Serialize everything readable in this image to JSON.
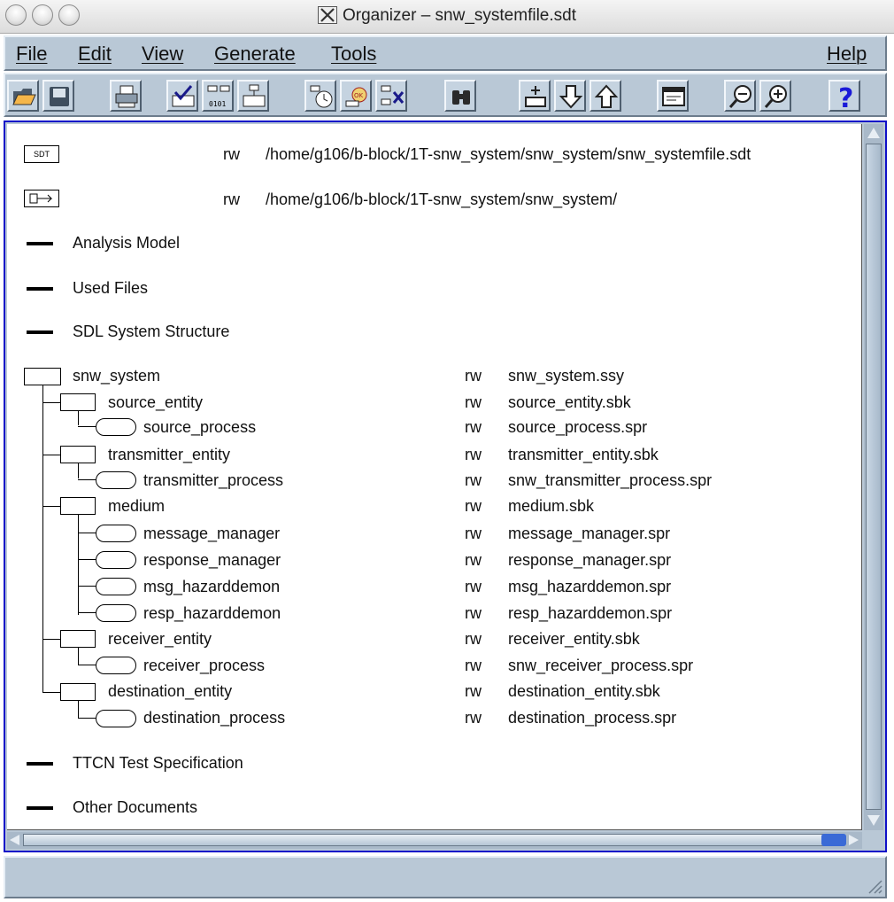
{
  "window": {
    "title": "Organizer – snw_systemfile.sdt"
  },
  "menu": {
    "items": [
      {
        "id": "file",
        "label": "File"
      },
      {
        "id": "edit",
        "label": "Edit"
      },
      {
        "id": "view",
        "label": "View"
      },
      {
        "id": "generate",
        "label": "Generate"
      },
      {
        "id": "tools",
        "label": "Tools"
      },
      {
        "id": "help",
        "label": "Help"
      }
    ]
  },
  "toolbar": {
    "buttons": [
      {
        "id": "open",
        "icon": "open-folder-icon"
      },
      {
        "id": "save",
        "icon": "save-icon"
      },
      {
        "id": "print",
        "icon": "print-icon"
      },
      {
        "id": "check",
        "icon": "check-icon"
      },
      {
        "id": "generate",
        "icon": "generate-icon"
      },
      {
        "id": "editor",
        "icon": "edit-diagram-icon"
      },
      {
        "id": "simulate",
        "icon": "simulate-icon"
      },
      {
        "id": "validate",
        "icon": "validate-icon"
      },
      {
        "id": "remove",
        "icon": "remove-icon"
      },
      {
        "id": "find",
        "icon": "binoculars-icon"
      },
      {
        "id": "add",
        "icon": "add-item-icon"
      },
      {
        "id": "move-down",
        "icon": "arrow-down-icon"
      },
      {
        "id": "move-up",
        "icon": "arrow-up-icon"
      },
      {
        "id": "window",
        "icon": "window-icon"
      },
      {
        "id": "zoom-out",
        "icon": "zoom-out-icon"
      },
      {
        "id": "zoom-in",
        "icon": "zoom-in-icon"
      },
      {
        "id": "help",
        "icon": "help-icon",
        "glyph": "?"
      }
    ]
  },
  "header_rows": [
    {
      "icon_text": "SDT",
      "perm": "rw",
      "path": "/home/g106/b-block/1T-snw_system/snw_system/snw_systemfile.sdt"
    },
    {
      "icon_text": "",
      "perm": "rw",
      "path": "/home/g106/b-block/1T-snw_system/snw_system/"
    }
  ],
  "chapters": {
    "analysis": "Analysis Model",
    "used_files": "Used Files",
    "sdl_structure": "SDL System Structure",
    "ttcn": "TTCN Test Specification",
    "other": "Other Documents"
  },
  "tree": [
    {
      "name": "snw_system",
      "perm": "rw",
      "file": "snw_system.ssy"
    },
    {
      "name": "source_entity",
      "perm": "rw",
      "file": "source_entity.sbk"
    },
    {
      "name": "source_process",
      "perm": "rw",
      "file": "source_process.spr"
    },
    {
      "name": "transmitter_entity",
      "perm": "rw",
      "file": "transmitter_entity.sbk"
    },
    {
      "name": "transmitter_process",
      "perm": "rw",
      "file": "snw_transmitter_process.spr"
    },
    {
      "name": "medium",
      "perm": "rw",
      "file": "medium.sbk"
    },
    {
      "name": "message_manager",
      "perm": "rw",
      "file": "message_manager.spr"
    },
    {
      "name": "response_manager",
      "perm": "rw",
      "file": "response_manager.spr"
    },
    {
      "name": "msg_hazarddemon",
      "perm": "rw",
      "file": "msg_hazarddemon.spr"
    },
    {
      "name": "resp_hazarddemon",
      "perm": "rw",
      "file": "resp_hazarddemon.spr"
    },
    {
      "name": "receiver_entity",
      "perm": "rw",
      "file": "receiver_entity.sbk"
    },
    {
      "name": "receiver_process",
      "perm": "rw",
      "file": "snw_receiver_process.spr"
    },
    {
      "name": "destination_entity",
      "perm": "rw",
      "file": "destination_entity.sbk"
    },
    {
      "name": "destination_process",
      "perm": "rw",
      "file": "destination_process.spr"
    }
  ],
  "status": {
    "text": ""
  },
  "colors": {
    "chrome": "#b9c8d6",
    "focus_border": "#1010c8",
    "scroll_knob": "#3a6ad6"
  }
}
